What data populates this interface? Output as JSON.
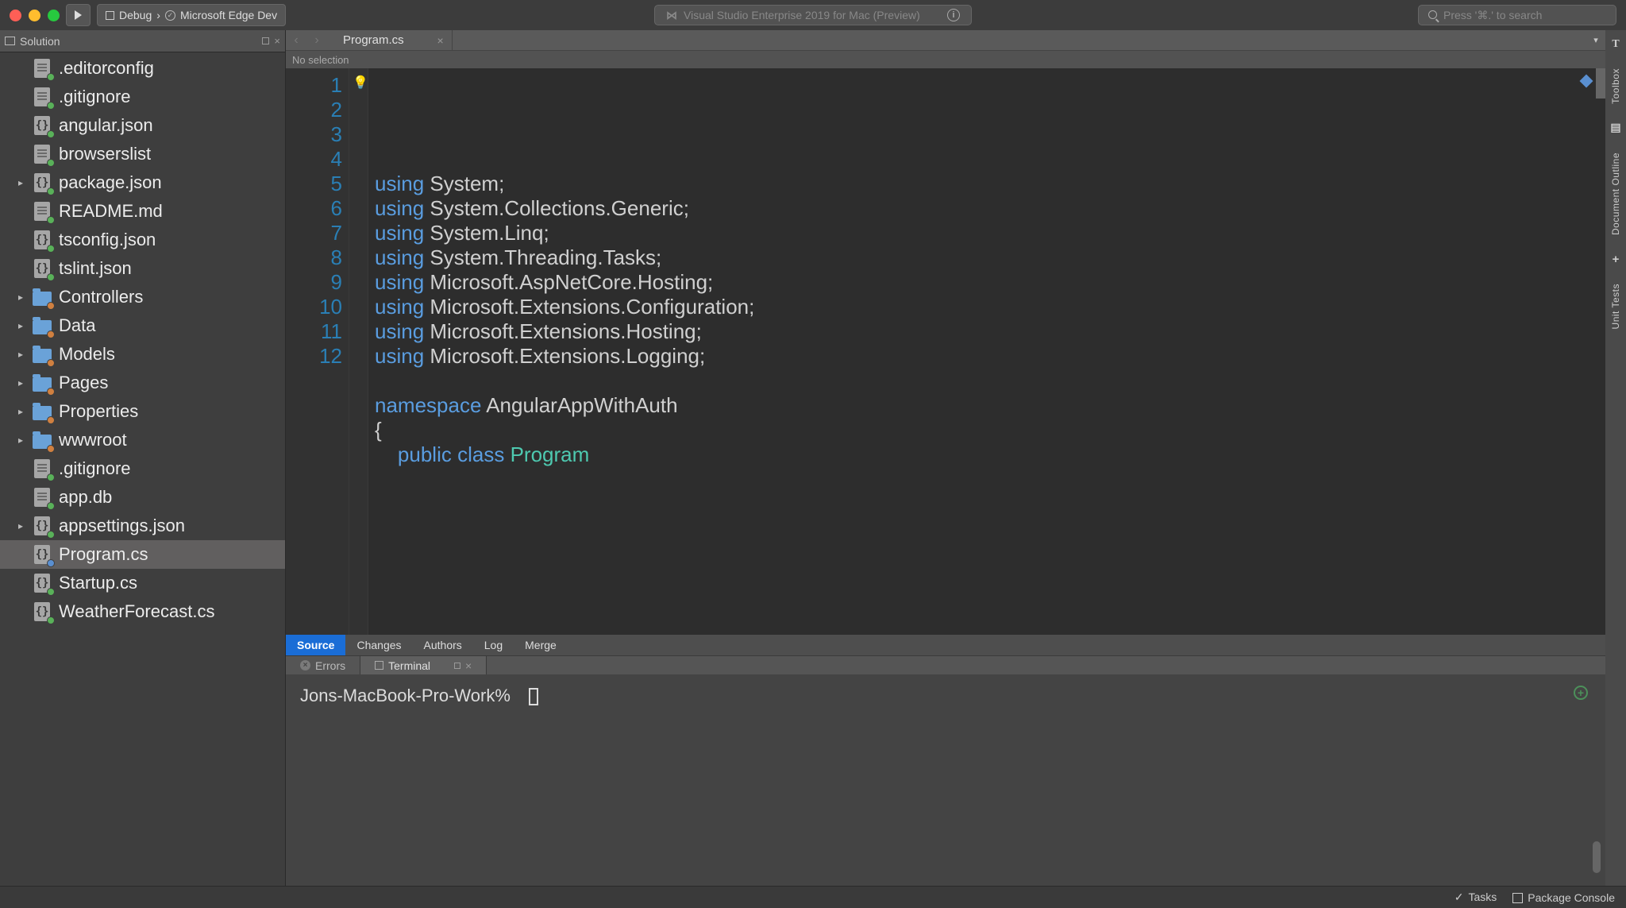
{
  "titlebar": {
    "config_label": "Debug",
    "target_label": "Microsoft Edge Dev",
    "app_title": "Visual Studio Enterprise 2019 for Mac (Preview)",
    "search_placeholder": "Press '⌘.' to search"
  },
  "sidebar": {
    "title": "Solution",
    "items": [
      {
        "name": ".editorconfig",
        "kind": "file",
        "badge": "green",
        "expand": ""
      },
      {
        "name": ".gitignore",
        "kind": "file",
        "badge": "green",
        "expand": ""
      },
      {
        "name": "angular.json",
        "kind": "brace",
        "badge": "green",
        "expand": ""
      },
      {
        "name": "browserslist",
        "kind": "file",
        "badge": "green",
        "expand": ""
      },
      {
        "name": "package.json",
        "kind": "brace",
        "badge": "green",
        "expand": "▸"
      },
      {
        "name": "README.md",
        "kind": "file",
        "badge": "green",
        "expand": ""
      },
      {
        "name": "tsconfig.json",
        "kind": "brace",
        "badge": "green",
        "expand": ""
      },
      {
        "name": "tslint.json",
        "kind": "brace",
        "badge": "green",
        "expand": ""
      },
      {
        "name": "Controllers",
        "kind": "folder",
        "badge": "orange",
        "expand": "▸"
      },
      {
        "name": "Data",
        "kind": "folder",
        "badge": "orange",
        "expand": "▸"
      },
      {
        "name": "Models",
        "kind": "folder",
        "badge": "orange",
        "expand": "▸"
      },
      {
        "name": "Pages",
        "kind": "folder",
        "badge": "orange",
        "expand": "▸"
      },
      {
        "name": "Properties",
        "kind": "folder",
        "badge": "orange",
        "expand": "▸"
      },
      {
        "name": "wwwroot",
        "kind": "folder",
        "badge": "orange",
        "expand": "▸"
      },
      {
        "name": ".gitignore",
        "kind": "file",
        "badge": "green",
        "expand": ""
      },
      {
        "name": "app.db",
        "kind": "file",
        "badge": "green",
        "expand": ""
      },
      {
        "name": "appsettings.json",
        "kind": "brace",
        "badge": "green",
        "expand": "▸"
      },
      {
        "name": "Program.cs",
        "kind": "brace",
        "badge": "blue",
        "expand": "",
        "selected": true
      },
      {
        "name": "Startup.cs",
        "kind": "brace",
        "badge": "green",
        "expand": ""
      },
      {
        "name": "WeatherForecast.cs",
        "kind": "brace",
        "badge": "green",
        "expand": ""
      }
    ]
  },
  "editor": {
    "tab_label": "Program.cs",
    "breadcrumb": "No selection",
    "lines": [
      {
        "n": "1",
        "kw": "using",
        "rest": " System;"
      },
      {
        "n": "2",
        "kw": "using",
        "rest": " System.Collections.Generic;"
      },
      {
        "n": "3",
        "kw": "using",
        "rest": " System.Linq;"
      },
      {
        "n": "4",
        "kw": "using",
        "rest": " System.Threading.Tasks;"
      },
      {
        "n": "5",
        "kw": "using",
        "rest": " Microsoft.AspNetCore.Hosting;"
      },
      {
        "n": "6",
        "kw": "using",
        "rest": " Microsoft.Extensions.Configuration;"
      },
      {
        "n": "7",
        "kw": "using",
        "rest": " Microsoft.Extensions.Hosting;"
      },
      {
        "n": "8",
        "kw": "using",
        "rest": " Microsoft.Extensions.Logging;"
      },
      {
        "n": "9",
        "kw": "",
        "rest": ""
      },
      {
        "n": "10",
        "kw": "namespace",
        "rest": " AngularAppWithAuth"
      },
      {
        "n": "11",
        "kw": "",
        "rest": "{"
      },
      {
        "n": "12",
        "indent": "    ",
        "kw": "public",
        "kw2": "class",
        "type": "Program"
      }
    ]
  },
  "srcbar": {
    "tabs": [
      "Source",
      "Changes",
      "Authors",
      "Log",
      "Merge"
    ],
    "active": 0
  },
  "lowtabs": {
    "errors": "Errors",
    "terminal": "Terminal"
  },
  "terminal": {
    "prompt": "Jons-MacBook-Pro-Work%"
  },
  "statusbar": {
    "tasks": "Tasks",
    "package": "Package Console"
  },
  "rightstrip": {
    "toolbox": "Toolbox",
    "outline": "Document Outline",
    "unittests": "Unit Tests"
  }
}
